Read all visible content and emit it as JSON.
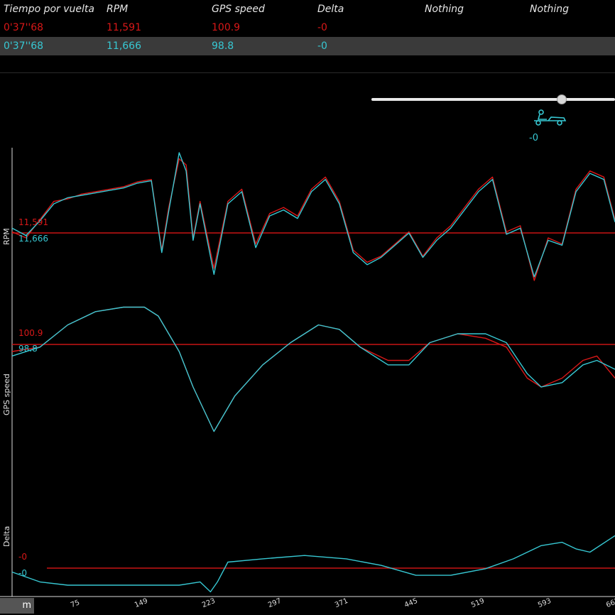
{
  "header": {
    "columns": [
      "Tiempo por vuelta",
      "RPM",
      "GPS speed",
      "Delta",
      "Nothing",
      "Nothing"
    ]
  },
  "laps": [
    {
      "time": "0'37''68",
      "rpm": "11,591",
      "gps_speed": "100.9",
      "delta": "-0",
      "color": "#d81818"
    },
    {
      "time": "0'37''68",
      "rpm": "11,666",
      "gps_speed": "98.8",
      "delta": "-0",
      "color": "#37c8d3"
    }
  ],
  "kart": {
    "delta": "-0",
    "icon": "kart-icon"
  },
  "slider": {
    "position": 0.78
  },
  "panels": {
    "rpm": {
      "label": "RPM",
      "red_value": "11,591",
      "cyan_value": "11,666"
    },
    "speed": {
      "label": "GPS speed",
      "red_value": "100.9",
      "cyan_value": "98.8"
    },
    "delta": {
      "label": "Delta",
      "red_value": "-0",
      "cyan_value": "-0"
    }
  },
  "xaxis": {
    "unit": "m",
    "ticks": [
      "75",
      "149",
      "223",
      "297",
      "371",
      "445",
      "519",
      "593",
      "667"
    ]
  },
  "chart_data": [
    {
      "type": "line",
      "ylabel": "RPM",
      "x": [
        0,
        20,
        40,
        60,
        80,
        100,
        120,
        140,
        160,
        180,
        200,
        215,
        225,
        240,
        250,
        260,
        270,
        290,
        310,
        330,
        350,
        370,
        390,
        410,
        430,
        450,
        470,
        490,
        510,
        530,
        550,
        570,
        590,
        610,
        630,
        650,
        670,
        690,
        710,
        730,
        750,
        770,
        790,
        810,
        830,
        850,
        866
      ],
      "series": [
        {
          "color": "#d81818",
          "values": [
            35,
            30,
            45,
            60,
            62,
            66,
            68,
            70,
            72,
            76,
            78,
            20,
            55,
            95,
            90,
            30,
            60,
            5,
            60,
            70,
            25,
            50,
            55,
            48,
            70,
            80,
            60,
            20,
            10,
            15,
            25,
            35,
            15,
            30,
            40,
            55,
            70,
            80,
            35,
            40,
            -5,
            30,
            25,
            70,
            85,
            80,
            45
          ],
          "name": ""
        },
        {
          "color": "#37c8d3",
          "values": [
            38,
            32,
            44,
            58,
            63,
            65,
            67,
            69,
            71,
            75,
            77,
            18,
            52,
            100,
            85,
            28,
            58,
            0,
            58,
            68,
            22,
            48,
            53,
            46,
            68,
            78,
            58,
            18,
            8,
            14,
            24,
            34,
            14,
            28,
            38,
            53,
            68,
            78,
            33,
            38,
            -2,
            28,
            24,
            68,
            83,
            78,
            43
          ],
          "name": ""
        }
      ]
    },
    {
      "type": "line",
      "ylabel": "GPS speed",
      "x": [
        0,
        40,
        80,
        120,
        160,
        190,
        210,
        240,
        260,
        290,
        320,
        360,
        400,
        440,
        470,
        500,
        540,
        570,
        600,
        640,
        680,
        710,
        740,
        760,
        790,
        820,
        840,
        866
      ],
      "series": [
        {
          "color": "#d81818",
          "values": [
            98,
            99,
            104,
            107,
            108,
            108,
            106,
            98,
            90,
            80,
            88,
            95,
            100,
            104,
            103,
            99,
            96,
            96,
            100,
            102,
            101,
            99,
            92,
            90,
            92,
            96,
            97,
            92
          ],
          "name": ""
        },
        {
          "color": "#37c8d3",
          "values": [
            97,
            99,
            104,
            107,
            108,
            108,
            106,
            98,
            90,
            80,
            88,
            95,
            100,
            104,
            103,
            99,
            95,
            95,
            100,
            102,
            102,
            100,
            93,
            90,
            91,
            95,
            96,
            94
          ],
          "name": ""
        }
      ]
    },
    {
      "type": "line",
      "ylabel": "Delta",
      "x": [
        0,
        40,
        80,
        120,
        160,
        200,
        240,
        270,
        285,
        295,
        310,
        360,
        420,
        480,
        530,
        580,
        630,
        680,
        720,
        760,
        790,
        810,
        830,
        866
      ],
      "series": [
        {
          "color": "#37c8d3",
          "values": [
            -0.01,
            -0.04,
            -0.05,
            -0.05,
            -0.05,
            -0.05,
            -0.05,
            -0.04,
            -0.07,
            -0.04,
            0.02,
            0.03,
            0.04,
            0.03,
            0.01,
            -0.02,
            -0.02,
            0.0,
            0.03,
            0.07,
            0.08,
            0.06,
            0.05,
            0.1
          ],
          "name": ""
        }
      ],
      "ylim": [
        -0.08,
        0.12
      ]
    }
  ]
}
